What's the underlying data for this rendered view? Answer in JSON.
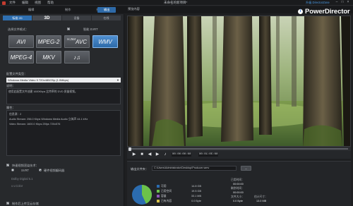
{
  "window": {
    "menu": [
      "文件",
      "编辑",
      "视图",
      "帮助"
    ],
    "title": "未命名的新项目*",
    "upgrade_link": "升级 DirectorZone"
  },
  "mode_tabs": {
    "edit": "编辑",
    "produce": "制作",
    "disc": "光盘",
    "active": "输出"
  },
  "brand": {
    "badge": "i",
    "name": "PowerDirector"
  },
  "left_panel": {
    "subtabs": [
      "标准 2D",
      "3D",
      "设备",
      "在线"
    ],
    "format_section_label": "选择文件格式：",
    "svrt_label": "智能 SVRT",
    "formats": [
      "AVI",
      "MPEG-2",
      "AVC",
      "WMV",
      "MPEG-4",
      "MKV",
      "♪♫"
    ],
    "avc_superscript": "H.264",
    "selected_format": "WMV",
    "profile_label": "配置文件类型：",
    "profile_value": "Windows Media Video 9 720x480/25p (1.0Mbps)",
    "desc_label": "说明：",
    "desc_text": "使用此配置文件创建 1600Kbps 比特率的 DVD 质量视频。",
    "info_label": "属性：",
    "info_lines": [
      "信息源：2",
      "Audio Stream:  256.0 Kbps  Windows Media Audio  立体声  44.1 kHz",
      "Video Stream:  1600.0 Kbps  25fps  720x576"
    ],
    "fast_render_label": "快速视频渲染技术：",
    "svrt_opt": "SVRT",
    "hw_opt": "硬件视频编码器",
    "dolby_label": "Dolby Digital 5.1",
    "truecolor_label": "x.v.Color",
    "upload_label": "制作后上传至云存储"
  },
  "preview": {
    "header": "预览内容",
    "timecode_start": "00:00:00:00",
    "timecode_end": "00:01:05:00",
    "buttons": [
      "play-icon",
      "stop-icon",
      "prev-icon",
      "next-icon",
      "volume-icon"
    ]
  },
  "output": {
    "folder_label": "输出文件夹：",
    "path": "C:\\Users\\Administrator\\Desktop\\Producer.wmv",
    "browse_label": "...",
    "legend": [
      {
        "label": "可用",
        "value": "14.8 GB",
        "color": "#2b6cb0"
      },
      {
        "label": "已用空间",
        "value": "19.5 GB",
        "color": "#6cc24a"
      },
      {
        "label": "容量",
        "value": "33.1 MB",
        "color": "#8e57b8"
      },
      {
        "label": "已有内容",
        "value": "0.0 Byte",
        "color": "#d7c24a"
      }
    ],
    "stats": [
      {
        "label": "已用时间：",
        "value": "00:00:00"
      },
      {
        "label": "剩余时间：",
        "value": "00:00:00"
      },
      {
        "label": "文件大小：",
        "value": "0.0 Byte"
      },
      {
        "label": "估计尺寸：",
        "value": "13.0 MB"
      }
    ],
    "pie_fraction_used": 0.43
  },
  "colors": {
    "accent": "#2e6aa8",
    "panel": "#27292c",
    "background": "#1e1f21"
  }
}
